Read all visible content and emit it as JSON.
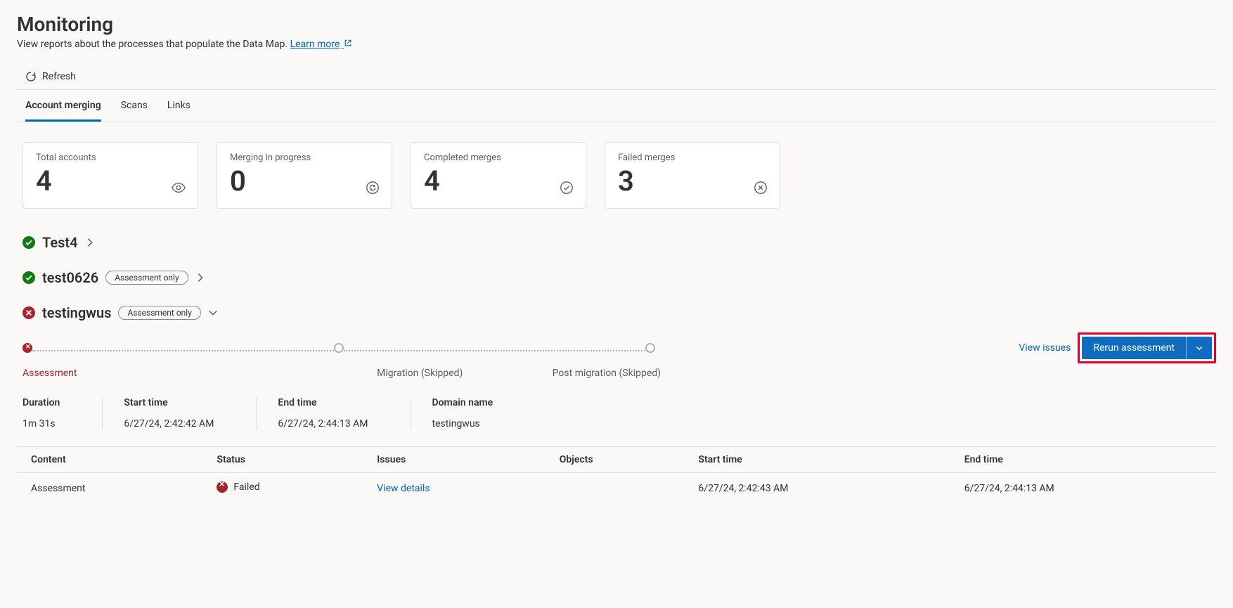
{
  "header": {
    "title": "Monitoring",
    "subtitle_pre": "View reports about the processes that populate the Data Map. ",
    "learn_more": "Learn more"
  },
  "toolbar": {
    "refresh": "Refresh"
  },
  "tabs": [
    "Account merging",
    "Scans",
    "Links"
  ],
  "active_tab_index": 0,
  "cards": [
    {
      "label": "Total accounts",
      "value": "4",
      "icon": "eye"
    },
    {
      "label": "Merging in progress",
      "value": "0",
      "icon": "sync"
    },
    {
      "label": "Completed merges",
      "value": "4",
      "icon": "check-circle"
    },
    {
      "label": "Failed merges",
      "value": "3",
      "icon": "x-circle"
    }
  ],
  "accounts": [
    {
      "name": "Test4",
      "status": "success",
      "chip": null,
      "expanded": false
    },
    {
      "name": "test0626",
      "status": "success",
      "chip": "Assessment only",
      "expanded": false
    },
    {
      "name": "testingwus",
      "status": "error",
      "chip": "Assessment only",
      "expanded": true
    }
  ],
  "stages": {
    "assessment": "Assessment",
    "migration": "Migration (Skipped)",
    "post_migration": "Post migration (Skipped)"
  },
  "actions": {
    "view_issues": "View issues",
    "rerun_assessment": "Rerun assessment"
  },
  "details": {
    "duration_label": "Duration",
    "duration_value": "1m 31s",
    "start_label": "Start time",
    "start_value": "6/27/24, 2:42:42 AM",
    "end_label": "End time",
    "end_value": "6/27/24, 2:44:13 AM",
    "domain_label": "Domain name",
    "domain_value": "testingwus"
  },
  "table": {
    "headers": [
      "Content",
      "Status",
      "Issues",
      "Objects",
      "Start time",
      "End time"
    ],
    "rows": [
      {
        "content": "Assessment",
        "status": "Failed",
        "issues": "View details",
        "objects": "",
        "start": "6/27/24, 2:42:43 AM",
        "end": "6/27/24, 2:44:13 AM"
      }
    ]
  }
}
